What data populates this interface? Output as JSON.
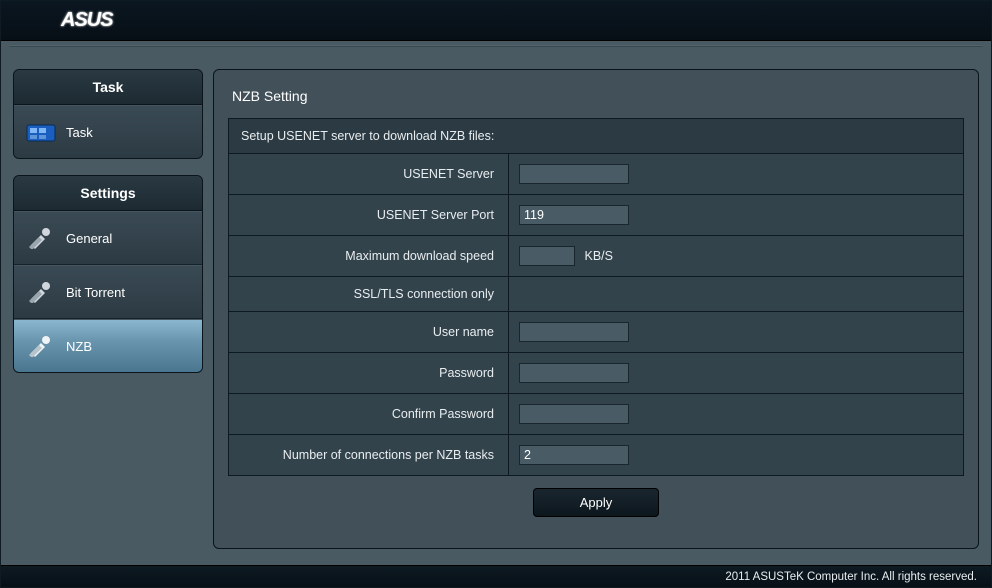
{
  "brand": "ASUS",
  "sidebar": {
    "task_header": "Task",
    "task_item": "Task",
    "settings_header": "Settings",
    "items": [
      {
        "label": "General"
      },
      {
        "label": "Bit Torrent"
      },
      {
        "label": "NZB"
      }
    ]
  },
  "page": {
    "title": "NZB Setting",
    "section_desc": "Setup USENET server to download NZB files:",
    "fields": {
      "usenet_server": {
        "label": "USENET Server",
        "value": ""
      },
      "usenet_port": {
        "label": "USENET Server Port",
        "value": "119"
      },
      "max_speed": {
        "label": "Maximum download speed",
        "value": "",
        "unit": "KB/S"
      },
      "ssl_only": {
        "label": "SSL/TLS connection only"
      },
      "username": {
        "label": "User name",
        "value": ""
      },
      "password": {
        "label": "Password",
        "value": ""
      },
      "confirm_pw": {
        "label": "Confirm Password",
        "value": ""
      },
      "connections": {
        "label": "Number of connections per NZB tasks",
        "value": "2"
      }
    },
    "apply_label": "Apply"
  },
  "footer": "2011 ASUSTeK Computer Inc. All rights reserved."
}
